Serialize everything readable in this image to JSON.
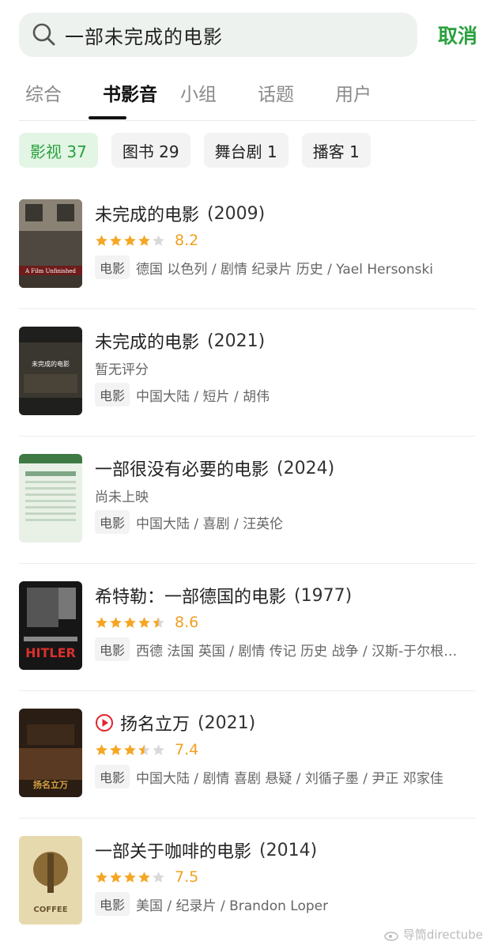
{
  "search": {
    "query": "一部未完成的电影",
    "cancel_label": "取消"
  },
  "tabs": [
    {
      "label": "综合",
      "active": false
    },
    {
      "label": "书影音",
      "active": true
    },
    {
      "label": "小组",
      "active": false
    },
    {
      "label": "话题",
      "active": false
    },
    {
      "label": "用户",
      "active": false
    }
  ],
  "chips": [
    {
      "label": "影视 37",
      "active": true
    },
    {
      "label": "图书 29",
      "active": false
    },
    {
      "label": "舞台剧 1",
      "active": false
    },
    {
      "label": "播客 1",
      "active": false
    }
  ],
  "results": [
    {
      "title": "未完成的电影",
      "year": "(2009)",
      "stars": 4,
      "score": "8.2",
      "no_rating": "",
      "type": "电影",
      "meta": "德国 以色列 / 剧情 纪录片 历史 / Yael Hersonski",
      "poster_text": "A Film Unfinished",
      "has_play": false
    },
    {
      "title": "未完成的电影",
      "year": "(2021)",
      "stars": 0,
      "score": "",
      "no_rating": "暂无评分",
      "type": "电影",
      "meta": "中国大陆 / 短片 / 胡伟",
      "poster_text": "未完成的电影",
      "has_play": false
    },
    {
      "title": "一部很没有必要的电影",
      "year": "(2024)",
      "stars": 0,
      "score": "",
      "no_rating": "尚未上映",
      "type": "电影",
      "meta": "中国大陆 / 喜剧 / 汪英伦",
      "poster_text": "",
      "has_play": false
    },
    {
      "title": "希特勒：一部德国的电影",
      "year": "(1977)",
      "stars": 4.5,
      "score": "8.6",
      "no_rating": "",
      "type": "电影",
      "meta": "西德 法国 英国 / 剧情 传记 历史 战争 / 汉斯-于尔根…",
      "poster_text": "HITLER",
      "has_play": false
    },
    {
      "title": "扬名立万",
      "year": "(2021)",
      "stars": 3.5,
      "score": "7.4",
      "no_rating": "",
      "type": "电影",
      "meta": "中国大陆 / 剧情 喜剧 悬疑 / 刘循子墨 / 尹正 邓家佳",
      "poster_text": "扬名立万",
      "has_play": true
    },
    {
      "title": "一部关于咖啡的电影",
      "year": "(2014)",
      "stars": 4,
      "score": "7.5",
      "no_rating": "",
      "type": "电影",
      "meta": "美国 / 纪录片 / Brandon Loper",
      "poster_text": "COFFEE",
      "has_play": false
    }
  ],
  "watermark": "导筒directube",
  "colors": {
    "accent": "#2aa13e",
    "star": "#f5a623",
    "star_empty": "#d9d9d9"
  }
}
